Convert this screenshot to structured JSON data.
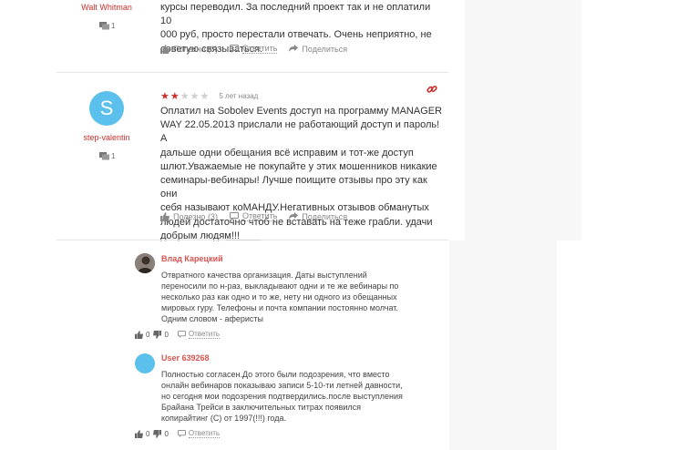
{
  "review1": {
    "author": "Walt Whitman",
    "comments_count": "1",
    "text_lines": [
      "курсы переводил. За последний проект так и не оплатили 10",
      "000 руб, просто перестали отвечать. Очень неприятно, не",
      "советую связываться."
    ],
    "helpful_label": "Полезно (0)",
    "reply_label": "Ответить",
    "share_label": "Поделиться"
  },
  "review2": {
    "avatar_letter": "S",
    "author": "step-valentin",
    "comments_count": "1",
    "rating": 2,
    "rating_max": 5,
    "time_ago": "5 лет назад",
    "text_lines": [
      "Оплатил на Sobolev Events доступ на программу MANAGER",
      "WAY 22.05.2013 прислали не работающий доступ и пароль! А",
      "дальше одни обещания всё исправим и тот-же доступ",
      "шлют.Уважаемые не покупайте у этих мошенников никакие",
      "семинары-вебинары! Лучше поищите отзывы про эту как они",
      "себя называют коМАНДУ.Негативных отзывов обманутых",
      "людей достаточно чтоб не вставать на теже грабли. удачи",
      "добрым людям!!!"
    ],
    "helpful_label": "Полезно (3)",
    "reply_label": "Ответить",
    "share_label": "Поделиться"
  },
  "replies": [
    {
      "author": "Влад Карецкий",
      "text_lines": [
        "Отвратного качества организация. Даты выступлений",
        "переносили по н-раз, выкладывают одни и те же вебинары по",
        "несколько раз как одно и то же, нету ни одного из обещанных",
        "мировых гуру. Телефоны и почта компании постоянно молчат.",
        "Одним словом - аферисты"
      ],
      "likes": "0",
      "dislikes": "0",
      "reply_label": "Ответить"
    },
    {
      "author": "User 639268",
      "text_lines": [
        "Полностью согласен.До этого были подозрения, что вместо",
        "онлайн вебинаров показываю записи 5-10-ти летней давности,",
        "но сегодня мои подозрения подтвердились.после выступления",
        "Брайана Трейси в заключительных титрах появился",
        "копирайтинг (С) от 1997(!!!) года."
      ],
      "likes": "0",
      "dislikes": "0",
      "reply_label": "Ответить"
    }
  ],
  "colors": {
    "accent": "#c9302c",
    "avatar_blue": "#5bc0eb",
    "muted": "#888888"
  }
}
